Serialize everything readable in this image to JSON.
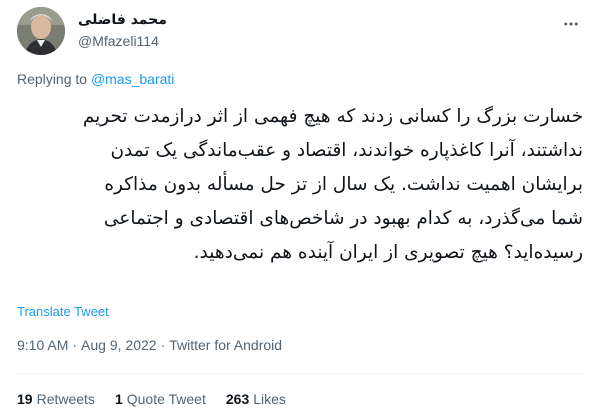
{
  "author": {
    "display_name": "محمد فاضلی",
    "handle": "@Mfazeli114"
  },
  "reply": {
    "prefix": "Replying to ",
    "handle": "@mas_barati"
  },
  "body": {
    "lines": [
      "خسارت بزرگ را کسانی زدند که هیچ فهمی از اثر درازمدت تحریم",
      "نداشتند، آنرا کاغذپاره خواندند، اقتصاد و عقب‌ماندگی یک تمدن",
      "برایشان اهمیت نداشت. یک سال از تز حل مسأله بدون مذاکره",
      "شما می‌گذرد، به کدام بهبود در شاخص‌های اقتصادی و اجتماعی",
      "رسیده‌اید؟ هیچ تصویری از ایران آینده هم نمی‌دهید."
    ]
  },
  "translate_label": "Translate Tweet",
  "meta": {
    "time": "9:10 AM",
    "separator": "·",
    "date": "Aug 9, 2022",
    "source": "Twitter for Android"
  },
  "stats": {
    "retweets_count": "19",
    "retweets_label": "Retweets",
    "quotes_count": "1",
    "quotes_label": "Quote Tweet",
    "likes_count": "263",
    "likes_label": "Likes"
  },
  "colors": {
    "accent": "#1d9bf0",
    "muted": "#536471",
    "text": "#0f1419"
  }
}
